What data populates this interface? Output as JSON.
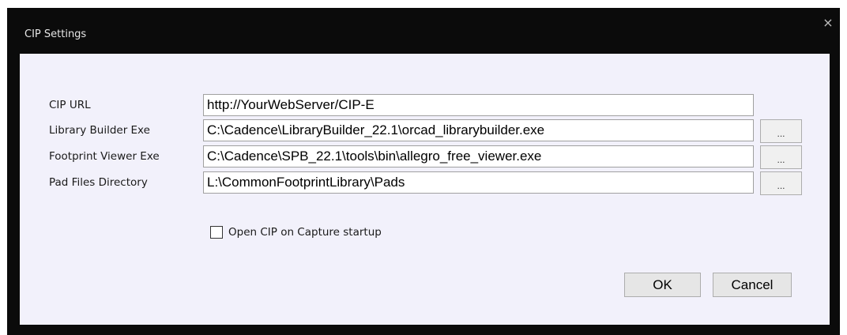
{
  "window": {
    "title": "CIP Settings",
    "close_glyph": "×"
  },
  "form": {
    "rows": [
      {
        "label": "CIP URL",
        "value": "http://YourWebServer/CIP-E"
      },
      {
        "label": "Library Builder Exe",
        "value": "C:\\Cadence\\LibraryBuilder_22.1\\orcad_librarybuilder.exe",
        "browse": "..."
      },
      {
        "label": "Footprint Viewer Exe",
        "value": "C:\\Cadence\\SPB_22.1\\tools\\bin\\allegro_free_viewer.exe",
        "browse": "..."
      },
      {
        "label": "Pad Files Directory",
        "value": "L:\\CommonFootprintLibrary\\Pads",
        "browse": "..."
      }
    ],
    "startup_checkbox": {
      "label": "Open CIP on Capture startup",
      "checked": false
    }
  },
  "buttons": {
    "ok": "OK",
    "cancel": "Cancel"
  }
}
